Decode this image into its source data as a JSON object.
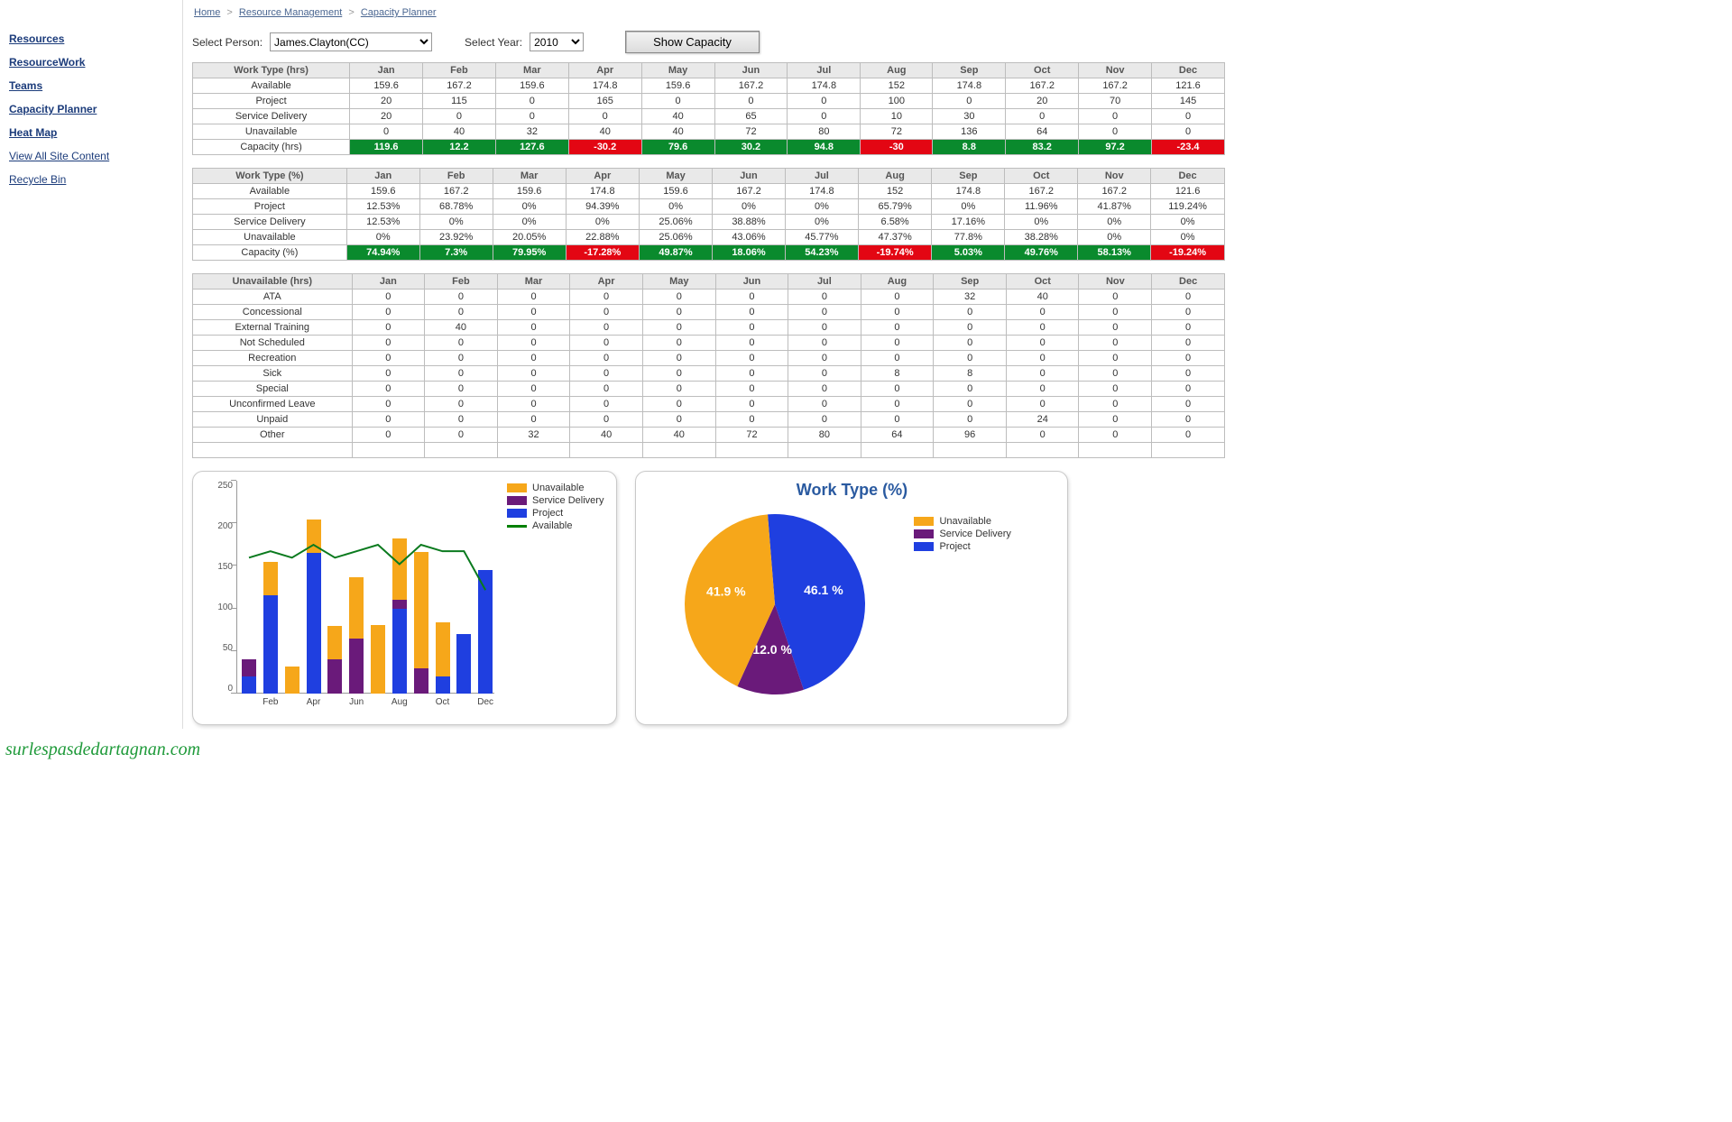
{
  "sidebar": {
    "items": [
      {
        "label": "Resources",
        "bold": true
      },
      {
        "label": "ResourceWork",
        "bold": true
      },
      {
        "label": "Teams",
        "bold": true
      },
      {
        "label": "Capacity Planner",
        "bold": true
      },
      {
        "label": "Heat Map",
        "bold": true
      },
      {
        "label": "View All Site Content",
        "bold": false
      },
      {
        "label": "Recycle Bin",
        "bold": false
      }
    ]
  },
  "breadcrumb": {
    "home": "Home",
    "rm": "Resource Management",
    "cp": "Capacity Planner"
  },
  "controls": {
    "select_person_label": "Select Person:",
    "person": "James.Clayton(CC)",
    "select_year_label": "Select Year:",
    "year": "2010",
    "show_btn": "Show Capacity"
  },
  "months": [
    "Jan",
    "Feb",
    "Mar",
    "Apr",
    "May",
    "Jun",
    "Jul",
    "Aug",
    "Sep",
    "Oct",
    "Nov",
    "Dec"
  ],
  "table_hrs": {
    "header": "Work Type (hrs)",
    "rows": [
      {
        "label": "Available",
        "v": [
          "159.6",
          "167.2",
          "159.6",
          "174.8",
          "159.6",
          "167.2",
          "174.8",
          "152",
          "174.8",
          "167.2",
          "167.2",
          "121.6"
        ]
      },
      {
        "label": "Project",
        "v": [
          "20",
          "115",
          "0",
          "165",
          "0",
          "0",
          "0",
          "100",
          "0",
          "20",
          "70",
          "145"
        ]
      },
      {
        "label": "Service Delivery",
        "v": [
          "20",
          "0",
          "0",
          "0",
          "40",
          "65",
          "0",
          "10",
          "30",
          "0",
          "0",
          "0"
        ]
      },
      {
        "label": "Unavailable",
        "v": [
          "0",
          "40",
          "32",
          "40",
          "40",
          "72",
          "80",
          "72",
          "136",
          "64",
          "0",
          "0"
        ]
      },
      {
        "label": "Capacity (hrs)",
        "v": [
          "119.6",
          "12.2",
          "127.6",
          "-30.2",
          "79.6",
          "30.2",
          "94.8",
          "-30",
          "8.8",
          "83.2",
          "97.2",
          "-23.4"
        ],
        "capacity": true
      }
    ]
  },
  "table_pct": {
    "header": "Work Type (%)",
    "rows": [
      {
        "label": "Available",
        "v": [
          "159.6",
          "167.2",
          "159.6",
          "174.8",
          "159.6",
          "167.2",
          "174.8",
          "152",
          "174.8",
          "167.2",
          "167.2",
          "121.6"
        ]
      },
      {
        "label": "Project",
        "v": [
          "12.53%",
          "68.78%",
          "0%",
          "94.39%",
          "0%",
          "0%",
          "0%",
          "65.79%",
          "0%",
          "11.96%",
          "41.87%",
          "119.24%"
        ]
      },
      {
        "label": "Service Delivery",
        "v": [
          "12.53%",
          "0%",
          "0%",
          "0%",
          "25.06%",
          "38.88%",
          "0%",
          "6.58%",
          "17.16%",
          "0%",
          "0%",
          "0%"
        ]
      },
      {
        "label": "Unavailable",
        "v": [
          "0%",
          "23.92%",
          "20.05%",
          "22.88%",
          "25.06%",
          "43.06%",
          "45.77%",
          "47.37%",
          "77.8%",
          "38.28%",
          "0%",
          "0%"
        ]
      },
      {
        "label": "Capacity (%)",
        "v": [
          "74.94%",
          "7.3%",
          "79.95%",
          "-17.28%",
          "49.87%",
          "18.06%",
          "54.23%",
          "-19.74%",
          "5.03%",
          "49.76%",
          "58.13%",
          "-19.24%"
        ],
        "capacity": true
      }
    ]
  },
  "table_unavail": {
    "header": "Unavailable (hrs)",
    "rows": [
      {
        "label": "ATA",
        "v": [
          "0",
          "0",
          "0",
          "0",
          "0",
          "0",
          "0",
          "0",
          "32",
          "40",
          "0",
          "0"
        ]
      },
      {
        "label": "Concessional",
        "v": [
          "0",
          "0",
          "0",
          "0",
          "0",
          "0",
          "0",
          "0",
          "0",
          "0",
          "0",
          "0"
        ]
      },
      {
        "label": "External Training",
        "v": [
          "0",
          "40",
          "0",
          "0",
          "0",
          "0",
          "0",
          "0",
          "0",
          "0",
          "0",
          "0"
        ]
      },
      {
        "label": "Not Scheduled",
        "v": [
          "0",
          "0",
          "0",
          "0",
          "0",
          "0",
          "0",
          "0",
          "0",
          "0",
          "0",
          "0"
        ]
      },
      {
        "label": "Recreation",
        "v": [
          "0",
          "0",
          "0",
          "0",
          "0",
          "0",
          "0",
          "0",
          "0",
          "0",
          "0",
          "0"
        ]
      },
      {
        "label": "Sick",
        "v": [
          "0",
          "0",
          "0",
          "0",
          "0",
          "0",
          "0",
          "8",
          "8",
          "0",
          "0",
          "0"
        ]
      },
      {
        "label": "Special",
        "v": [
          "0",
          "0",
          "0",
          "0",
          "0",
          "0",
          "0",
          "0",
          "0",
          "0",
          "0",
          "0"
        ]
      },
      {
        "label": "Unconfirmed Leave",
        "v": [
          "0",
          "0",
          "0",
          "0",
          "0",
          "0",
          "0",
          "0",
          "0",
          "0",
          "0",
          "0"
        ]
      },
      {
        "label": "Unpaid",
        "v": [
          "0",
          "0",
          "0",
          "0",
          "0",
          "0",
          "0",
          "0",
          "0",
          "24",
          "0",
          "0"
        ]
      },
      {
        "label": "Other",
        "v": [
          "0",
          "0",
          "32",
          "40",
          "40",
          "72",
          "80",
          "64",
          "96",
          "0",
          "0",
          "0"
        ]
      }
    ]
  },
  "legend": {
    "unavailable": "Unavailable",
    "service": "Service Delivery",
    "project": "Project",
    "available": "Available"
  },
  "colors": {
    "unavailable": "#f6a71a",
    "service": "#6a1a7a",
    "project": "#1f3fe0",
    "available": "#0a7a1e"
  },
  "pie": {
    "title": "Work Type (%)",
    "unavailable_label": "41.9 %",
    "service_label": "12.0 %",
    "project_label": "46.1 %"
  },
  "watermark": "surlespasdedartagnan.com",
  "chart_data": [
    {
      "type": "bar",
      "title": "",
      "stacked": true,
      "ylim": [
        0,
        250
      ],
      "yticks": [
        0,
        50,
        100,
        150,
        200,
        250
      ],
      "categories": [
        "Jan",
        "Feb",
        "Mar",
        "Apr",
        "May",
        "Jun",
        "Jul",
        "Aug",
        "Sep",
        "Oct",
        "Nov",
        "Dec"
      ],
      "xlabels_shown": [
        "Feb",
        "Apr",
        "Jun",
        "Aug",
        "Oct",
        "Dec"
      ],
      "series": [
        {
          "name": "Project",
          "color": "#1f3fe0",
          "values": [
            20,
            115,
            0,
            165,
            0,
            0,
            0,
            100,
            0,
            20,
            70,
            145
          ]
        },
        {
          "name": "Service Delivery",
          "color": "#6a1a7a",
          "values": [
            20,
            0,
            0,
            0,
            40,
            65,
            0,
            10,
            30,
            0,
            0,
            0
          ]
        },
        {
          "name": "Unavailable",
          "color": "#f6a71a",
          "values": [
            0,
            40,
            32,
            40,
            40,
            72,
            80,
            72,
            136,
            64,
            0,
            0
          ]
        }
      ],
      "line_series": {
        "name": "Available",
        "color": "#0a7a1e",
        "values": [
          159.6,
          167.2,
          159.6,
          174.8,
          159.6,
          167.2,
          174.8,
          152,
          174.8,
          167.2,
          167.2,
          121.6
        ]
      }
    },
    {
      "type": "pie",
      "title": "Work Type (%)",
      "series": [
        {
          "name": "Project",
          "color": "#1f3fe0",
          "value": 46.1
        },
        {
          "name": "Service Delivery",
          "color": "#6a1a7a",
          "value": 12.0
        },
        {
          "name": "Unavailable",
          "color": "#f6a71a",
          "value": 41.9
        }
      ]
    }
  ]
}
